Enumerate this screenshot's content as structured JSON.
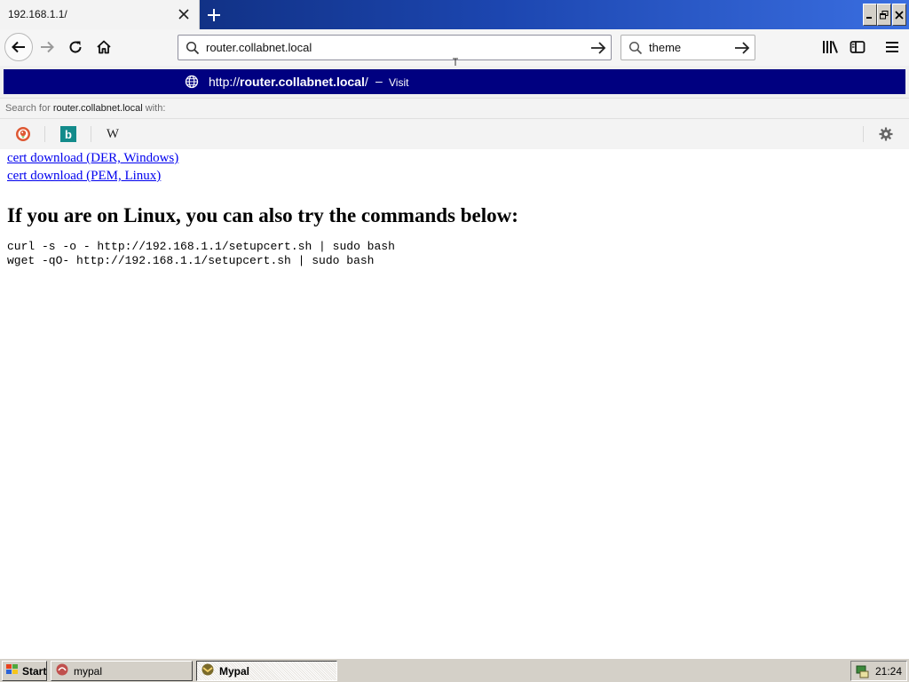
{
  "tab": {
    "title": "192.168.1.1/"
  },
  "urlbar": {
    "value": "router.collabnet.local"
  },
  "searchbar": {
    "value": "theme"
  },
  "popup": {
    "suggestion": {
      "url_prefix": "http://",
      "url_host": "router.collabnet.local",
      "url_suffix": "/",
      "dash": "–",
      "action": "Visit"
    },
    "search_with": {
      "prefix": "Search for",
      "term": "router.collabnet.local",
      "suffix": "with:"
    },
    "engines": [
      {
        "name": "DuckDuckGo",
        "icon": "duckduckgo-icon"
      },
      {
        "name": "Bing",
        "icon": "bing-icon",
        "glyph": "b"
      },
      {
        "name": "Wikipedia",
        "icon": "wikipedia-icon",
        "glyph": "W"
      }
    ]
  },
  "content": {
    "links": [
      "cert download (DER, Windows)",
      "cert download (PEM, Linux)"
    ],
    "heading": "If you are on Linux, you can also try the commands below:",
    "commands": [
      "curl -s -o - http://192.168.1.1/setupcert.sh | sudo bash",
      "wget -qO- http://192.168.1.1/setupcert.sh | sudo bash"
    ]
  },
  "taskbar": {
    "start_label": "Start",
    "tasks": [
      {
        "label": "mypal",
        "active": false
      },
      {
        "label": "Mypal",
        "active": true
      }
    ],
    "clock": "21:24"
  },
  "colors": {
    "titlebar": "#0a246a",
    "suggestion_highlight": "#000080",
    "link": "#0000ee",
    "taskbar": "#d4d0c8"
  }
}
